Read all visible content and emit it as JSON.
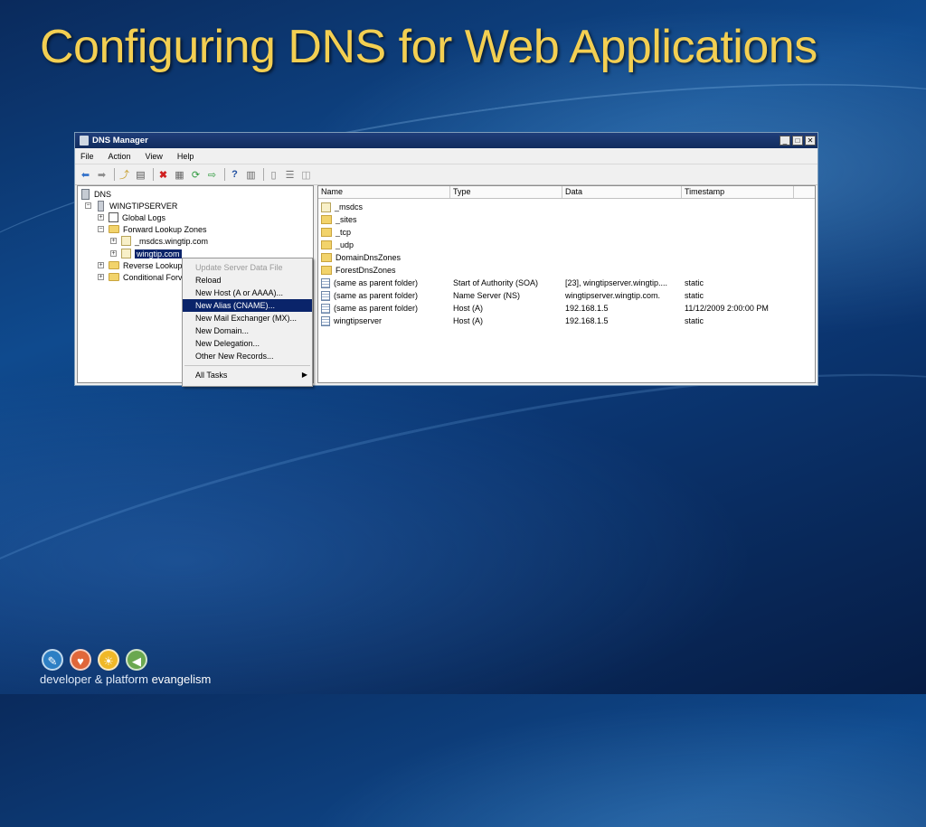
{
  "slide": {
    "title": "Configuring DNS for Web Applications",
    "brand_prefix": "developer & platform ",
    "brand_suffix": "evangelism"
  },
  "window": {
    "title": "DNS Manager",
    "menu": [
      "File",
      "Action",
      "View",
      "Help"
    ]
  },
  "tree": {
    "root": "DNS",
    "server": "WINGTIPSERVER",
    "global_logs": "Global Logs",
    "forward_zones": "Forward Lookup Zones",
    "zone_msdcs": "_msdcs.wingtip.com",
    "zone_wingtip": "wingtip.com",
    "reverse_zones": "Reverse Lookup",
    "conditional": "Conditional Forv"
  },
  "context_menu": {
    "items": [
      {
        "label": "Update Server Data File"
      },
      {
        "label": "Reload"
      },
      {
        "label": "New Host (A or AAAA)..."
      },
      {
        "label": "New Alias (CNAME)..."
      },
      {
        "label": "New Mail Exchanger (MX)..."
      },
      {
        "label": "New Domain..."
      },
      {
        "label": "New Delegation..."
      },
      {
        "label": "Other New Records..."
      }
    ],
    "all_tasks": "All Tasks"
  },
  "list": {
    "columns": [
      "Name",
      "Type",
      "Data",
      "Timestamp"
    ],
    "rows": [
      {
        "name": "_msdcs",
        "type": "",
        "data": "",
        "timestamp": "",
        "icon": "zone-icon"
      },
      {
        "name": "_sites",
        "type": "",
        "data": "",
        "timestamp": "",
        "icon": "folder-icon"
      },
      {
        "name": "_tcp",
        "type": "",
        "data": "",
        "timestamp": "",
        "icon": "folder-icon"
      },
      {
        "name": "_udp",
        "type": "",
        "data": "",
        "timestamp": "",
        "icon": "folder-icon"
      },
      {
        "name": "DomainDnsZones",
        "type": "",
        "data": "",
        "timestamp": "",
        "icon": "folder-icon"
      },
      {
        "name": "ForestDnsZones",
        "type": "",
        "data": "",
        "timestamp": "",
        "icon": "folder-icon"
      },
      {
        "name": "(same as parent folder)",
        "type": "Start of Authority (SOA)",
        "data": "[23], wingtipserver.wingtip....",
        "timestamp": "static",
        "icon": "record-icon"
      },
      {
        "name": "(same as parent folder)",
        "type": "Name Server (NS)",
        "data": "wingtipserver.wingtip.com.",
        "timestamp": "static",
        "icon": "record-icon"
      },
      {
        "name": "(same as parent folder)",
        "type": "Host (A)",
        "data": "192.168.1.5",
        "timestamp": "11/12/2009 2:00:00 PM",
        "icon": "record-icon"
      },
      {
        "name": "wingtipserver",
        "type": "Host (A)",
        "data": "192.168.1.5",
        "timestamp": "static",
        "icon": "record-icon"
      }
    ]
  },
  "colors": {
    "title": "#f3cf52",
    "selection": "#0a246a",
    "titlebar": "#1f3e7a"
  }
}
